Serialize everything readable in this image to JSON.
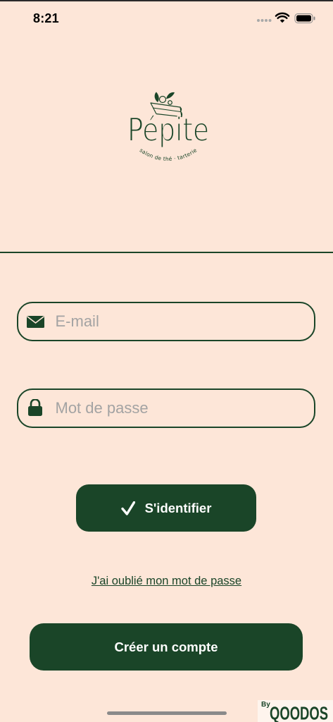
{
  "status_bar": {
    "time": "8:21",
    "icons": [
      "cellular-signal-icon",
      "wifi-icon",
      "battery-icon"
    ]
  },
  "logo": {
    "name": "Pépite",
    "tagline": "salon de thé · tarterie",
    "icon": "pie-slice-icon"
  },
  "login_form": {
    "email": {
      "placeholder": "E-mail",
      "value": "",
      "icon": "envelope-icon"
    },
    "password": {
      "placeholder": "Mot de passe",
      "value": "",
      "icon": "lock-icon"
    },
    "submit": {
      "label": "S'identifier",
      "icon": "checkmark-icon"
    },
    "forgot_password": "J'ai oublié mon mot de passe"
  },
  "create_account": {
    "label": "Créer un compte"
  },
  "footer": {
    "by": "By",
    "brand": "QOODOS"
  },
  "colors": {
    "background": "#fde6d8",
    "brand_green": "#1a4528",
    "placeholder": "#a3a3a3"
  }
}
